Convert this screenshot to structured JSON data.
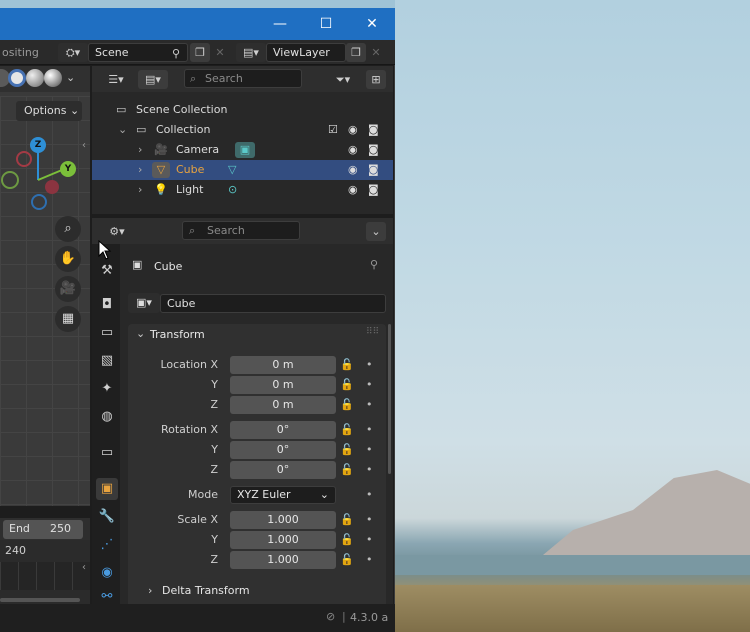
{
  "topbar": {
    "tab_partial": "ositing",
    "scene": "Scene",
    "view_layer": "ViewLayer"
  },
  "viewport": {
    "options_label": "Options",
    "axes": {
      "z": "Z",
      "y": "Y"
    }
  },
  "timeline": {
    "end_label": "End",
    "end_value": "250",
    "frame_value": "240"
  },
  "outliner": {
    "search_placeholder": "Search",
    "scene_collection": "Scene Collection",
    "collection": "Collection",
    "items": [
      {
        "label": "Camera"
      },
      {
        "label": "Cube"
      },
      {
        "label": "Light"
      }
    ]
  },
  "properties": {
    "search_placeholder": "Search",
    "object_name": "Cube",
    "object_field": "Cube",
    "transform": {
      "title": "Transform",
      "location_label": "Location X",
      "rotation_label": "Rotation X",
      "scale_label": "Scale X",
      "y_label": "Y",
      "z_label": "Z",
      "location": [
        "0 m",
        "0 m",
        "0 m"
      ],
      "rotation": [
        "0°",
        "0°",
        "0°"
      ],
      "mode_label": "Mode",
      "mode_value": "XYZ Euler",
      "scale": [
        "1.000",
        "1.000",
        "1.000"
      ]
    },
    "delta_transform": "Delta Transform"
  },
  "status": {
    "version": "4.3.0 a"
  },
  "colors": {
    "titlebar": "#1f6fc2",
    "selection": "#334d80",
    "accent_orange": "#e8a33f"
  }
}
